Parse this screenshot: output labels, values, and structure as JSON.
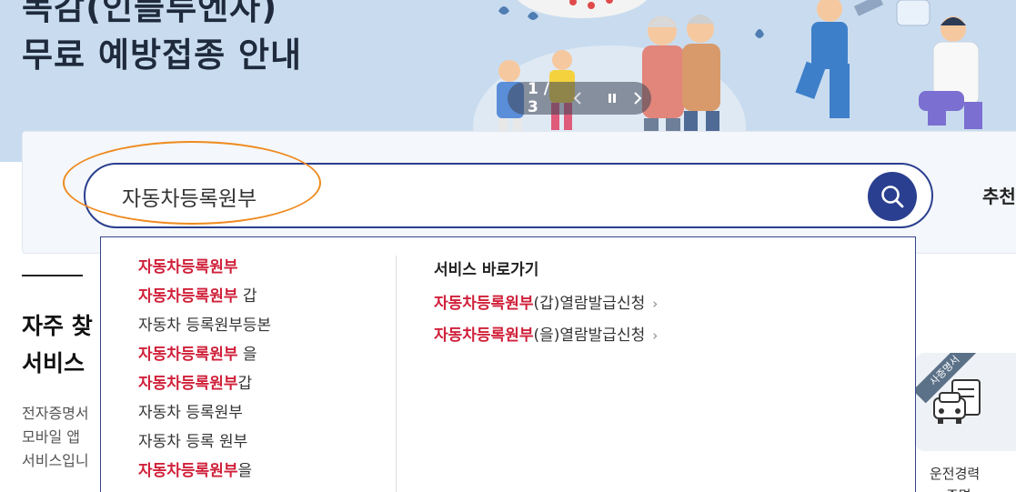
{
  "banner": {
    "title_line1": "독감(인플루엔자)",
    "title_line2": "무료 예방접종 안내",
    "slider": {
      "counter": "1 / 3",
      "prev_icon": "chevron-left-icon",
      "pause_icon": "pause-icon",
      "next_icon": "chevron-right-icon"
    }
  },
  "search": {
    "value": "자동차등록원부",
    "button_icon": "search-icon",
    "recommend_label": "추천"
  },
  "autocomplete": {
    "suggestions": [
      {
        "match": "자동차등록원부",
        "rest": ""
      },
      {
        "match": "자동차등록원부",
        "rest": " 갑"
      },
      {
        "match": "",
        "rest": "자동차 등록원부등본"
      },
      {
        "match": "자동차등록원부",
        "rest": " 을"
      },
      {
        "match": "자동차등록원부",
        "rest": "갑"
      },
      {
        "match": "",
        "rest": "자동차 등록원부"
      },
      {
        "match": "",
        "rest": "자동차 등록 원부"
      },
      {
        "match": "자동차등록원부",
        "rest": "을"
      }
    ],
    "services_title": "서비스 바로가기",
    "services": [
      {
        "match": "자동차등록원부",
        "rest": "(갑)열람발급신청"
      },
      {
        "match": "자동차등록원부",
        "rest": "(을)열람발급신청"
      }
    ]
  },
  "section": {
    "title_line1": "자주 찾",
    "title_line2": "서비스",
    "desc_line1": "전자증명서",
    "desc_line2": "모바일 앱",
    "desc_line3": "서비스입니"
  },
  "card": {
    "badge": "사증명서",
    "label_line1": "운전경력",
    "label_line2": "증명"
  },
  "colors": {
    "accent": "#2a3f8f",
    "highlight": "#d0213a",
    "annotation": "#ef8a1e",
    "banner_bg": "#c9dcef"
  }
}
